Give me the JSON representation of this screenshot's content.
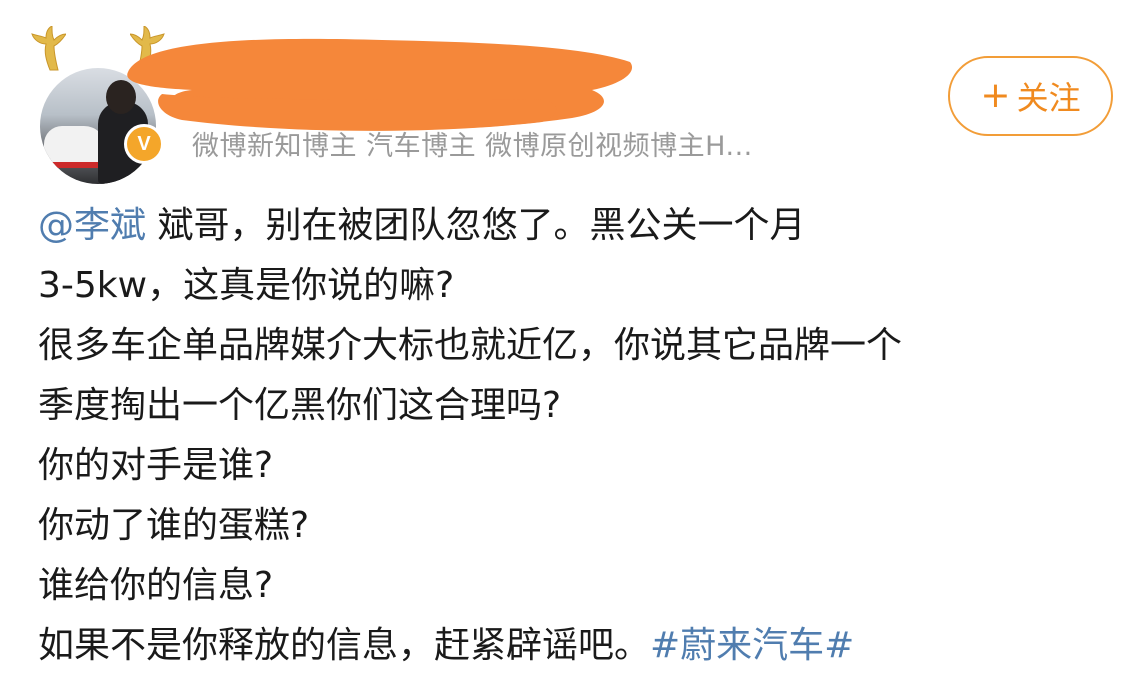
{
  "post": {
    "author": {
      "badge_letter": "V",
      "tags": "微博新知博主 汽车博主 微博原创视频博主H..."
    },
    "follow_label": "关注",
    "follow_plus": "+",
    "content": {
      "mention": "@李斌",
      "line1": " 斌哥，别在被团队忽悠了。黑公关一个月",
      "line2": "3-5kw，这真是你说的嘛?",
      "line3": "很多车企单品牌媒介大标也就近亿，你说其它品牌一个",
      "line4": "季度掏出一个亿黑你们这合理吗?",
      "line5": "你的对手是谁?",
      "line6": "你动了谁的蛋糕?",
      "line7": "谁给你的信息?",
      "line8": "如果不是你释放的信息，赶紧辟谣吧。",
      "hashtag": "#蔚来汽车#"
    },
    "colors": {
      "link": "#507daf",
      "follow": "#f08a1f",
      "verified": "#f4a62a",
      "redaction": "#f5873a"
    }
  }
}
